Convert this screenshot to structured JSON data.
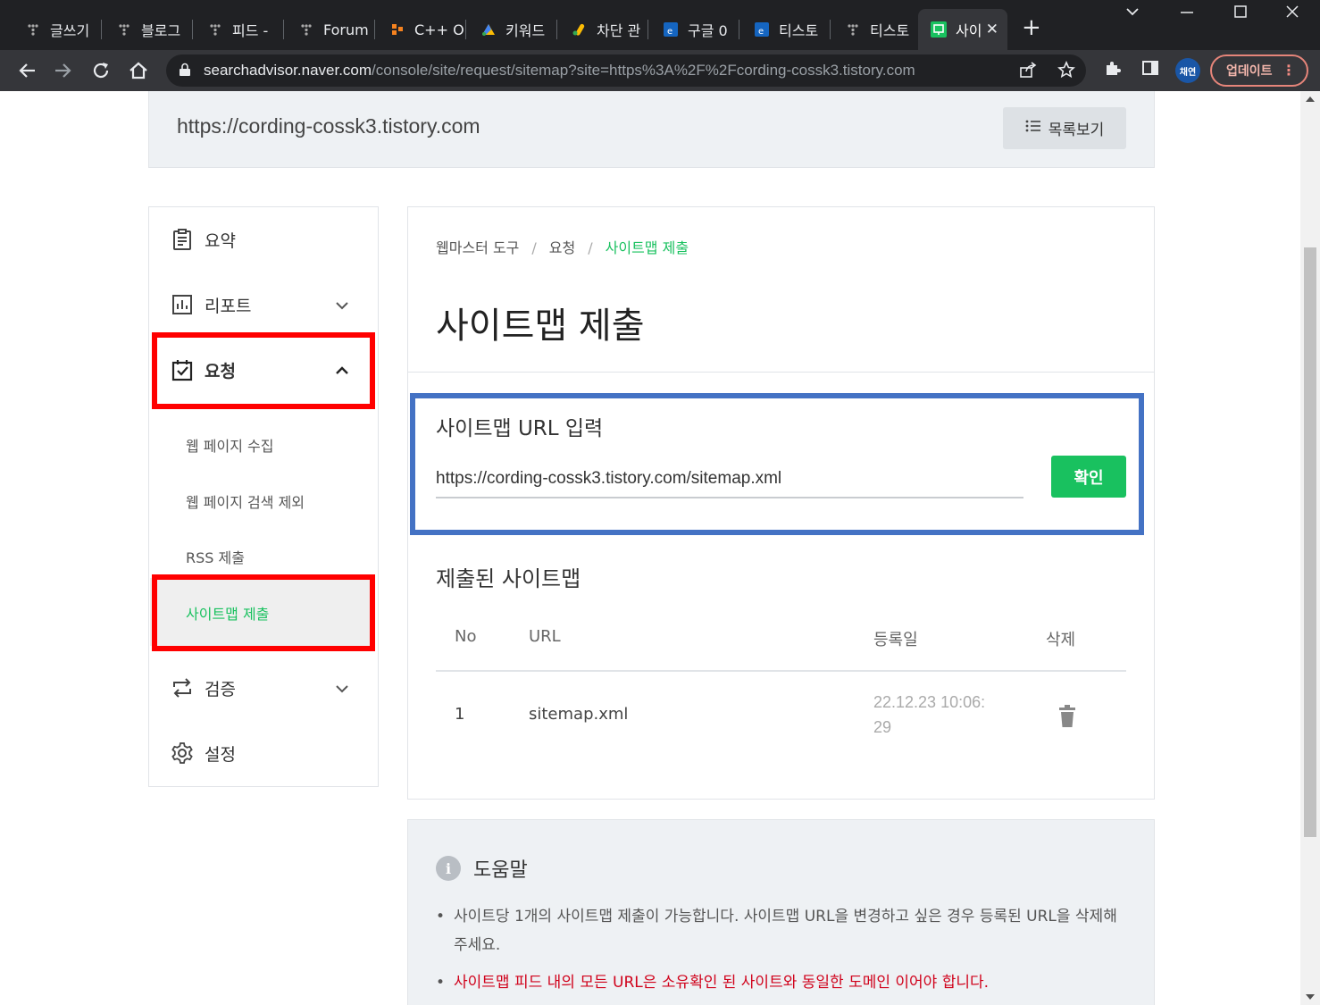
{
  "browser": {
    "tabs": [
      {
        "title": "글쓰기",
        "icon": "tistory-icon",
        "active": false
      },
      {
        "title": "블로그",
        "icon": "tistory-icon",
        "active": false
      },
      {
        "title": "피드 -",
        "icon": "tistory-icon",
        "active": false
      },
      {
        "title": "Forum",
        "icon": "tistory-icon",
        "active": false
      },
      {
        "title": "C++ O",
        "icon": "cplusplus-icon",
        "active": false
      },
      {
        "title": "키워드",
        "icon": "adsense-icon",
        "active": false
      },
      {
        "title": "차단 관",
        "icon": "google-ads-icon",
        "active": false
      },
      {
        "title": "구글 0",
        "icon": "edge-page-icon",
        "active": false
      },
      {
        "title": "티스토",
        "icon": "edge-page-icon",
        "active": false
      },
      {
        "title": "티스토",
        "icon": "tistory-icon",
        "active": false
      },
      {
        "title": "사이",
        "icon": "naver-searchadvisor-icon",
        "active": true
      }
    ],
    "new_tab_label": "+",
    "address": {
      "host": "searchadvisor.naver.com",
      "path": "/console/site/request/sitemap?site=https%3A%2F%2Fcording-cossk3.tistory.com"
    },
    "profile_label": "채연",
    "update_label": "업데이트"
  },
  "header": {
    "site_url": "https://cording-cossk3.tistory.com",
    "list_button_label": "목록보기"
  },
  "sidebar": {
    "items": [
      {
        "label": "요약",
        "icon": "clipboard-icon"
      },
      {
        "label": "리포트",
        "icon": "bar-chart-icon"
      },
      {
        "label": "요청",
        "icon": "checkbox-icon"
      },
      {
        "label": "검증",
        "icon": "repeat-icon"
      },
      {
        "label": "설정",
        "icon": "gear-icon"
      }
    ],
    "sub_items": [
      {
        "label": "웹 페이지 수집"
      },
      {
        "label": "웹 페이지 검색 제외"
      },
      {
        "label": "RSS 제출"
      },
      {
        "label": "사이트맵 제출"
      }
    ]
  },
  "main": {
    "breadcrumb": [
      "웹마스터 도구",
      "요청",
      "사이트맵 제출"
    ],
    "title": "사이트맵 제출",
    "input_label": "사이트맵 URL 입력",
    "input_value": "https://cording-cossk3.tistory.com/sitemap.xml",
    "confirm_label": "확인",
    "submitted_title": "제출된 사이트맵",
    "table": {
      "headers": [
        "No",
        "URL",
        "등록일",
        "삭제"
      ],
      "rows": [
        {
          "no": "1",
          "url": "sitemap.xml",
          "date_line1": "22.12.23 10:06:",
          "date_line2": "29"
        }
      ]
    }
  },
  "help": {
    "title": "도움말",
    "items": [
      "사이트당 1개의 사이트맵 제출이 가능합니다. 사이트맵 URL을 변경하고 싶은 경우 등록된 URL을 삭제해 주세요.",
      "사이트맵 피드 내의 모든 URL은 소유확인 된 사이트와 동일한 도메인 이어야 합니다."
    ]
  },
  "colors": {
    "accent_green": "#19c15f",
    "annotation_red": "#ff0000",
    "annotation_blue": "#4472c4",
    "warning_red": "#d0021b"
  }
}
